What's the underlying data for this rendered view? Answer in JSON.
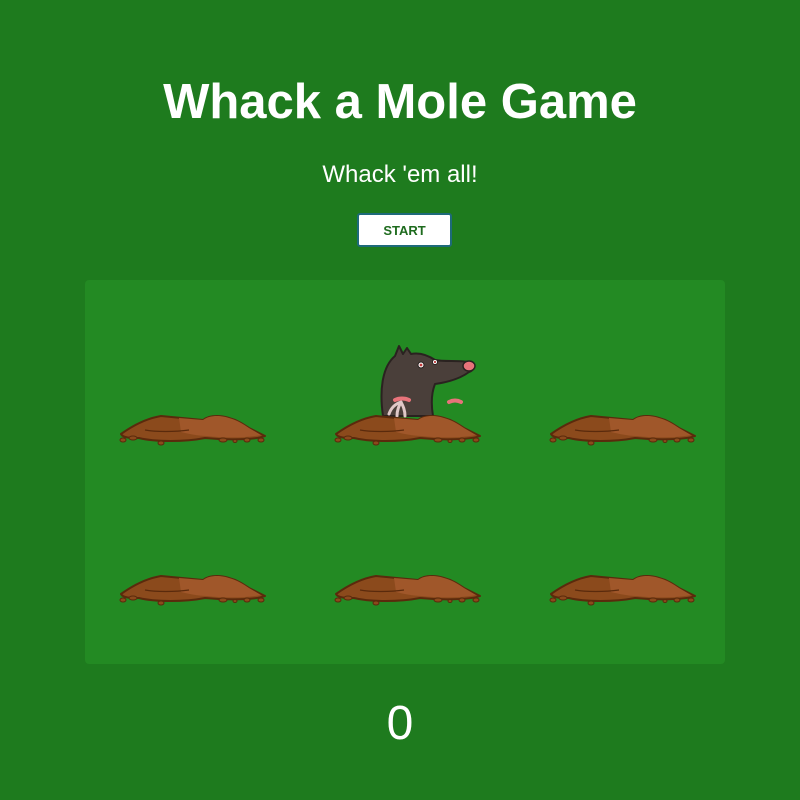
{
  "header": {
    "title": "Whack a Mole Game",
    "subtitle": "Whack 'em all!"
  },
  "controls": {
    "start_label": "START"
  },
  "board": {
    "rows": 2,
    "cols": 3,
    "active_mole_hole": 2
  },
  "score": {
    "value": "0"
  },
  "colors": {
    "background": "#1e7b1e",
    "board": "#238a23",
    "dirt": "#8b4a1c",
    "dirt_light": "#a0572a",
    "mole_body": "#4a3f3a",
    "mole_nose": "#e8737a"
  },
  "icons": {
    "hole": "dirt-mound-icon",
    "mole": "mole-icon"
  }
}
